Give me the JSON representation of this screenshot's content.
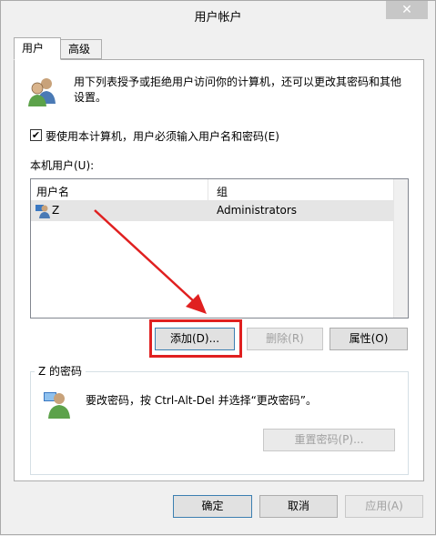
{
  "window": {
    "title": "用户帐户",
    "close_glyph": "✕"
  },
  "tabs": [
    {
      "label": "用户",
      "active": true
    },
    {
      "label": "高级",
      "active": false
    }
  ],
  "intro": {
    "text_line1": "用下列表授予或拒绝用户访问你的计算机，还可以更改其密码和其他",
    "text_line2": "设置。",
    "icon": "users-icon"
  },
  "require_login": {
    "checked": true,
    "check_glyph": "✔",
    "label": "要使用本计算机，用户必须输入用户名和密码(E)"
  },
  "users_list": {
    "label": "本机用户(U):",
    "columns": [
      "用户名",
      "组"
    ],
    "rows": [
      {
        "username": "Z",
        "group": "Administrators",
        "icon": "user-icon",
        "selected": true
      }
    ]
  },
  "list_buttons": {
    "add": "添加(D)...",
    "remove": "删除(R)",
    "properties": "属性(O)"
  },
  "password_group": {
    "title": "Z 的密码",
    "text": "要改密码，按 Ctrl-Alt-Del 并选择“更改密码”。",
    "icon": "user-key-icon",
    "reset_button": "重置密码(P)..."
  },
  "dialog_buttons": {
    "ok": "确定",
    "cancel": "取消",
    "apply": "应用(A)"
  },
  "annotation": {
    "color": "#e02020"
  }
}
